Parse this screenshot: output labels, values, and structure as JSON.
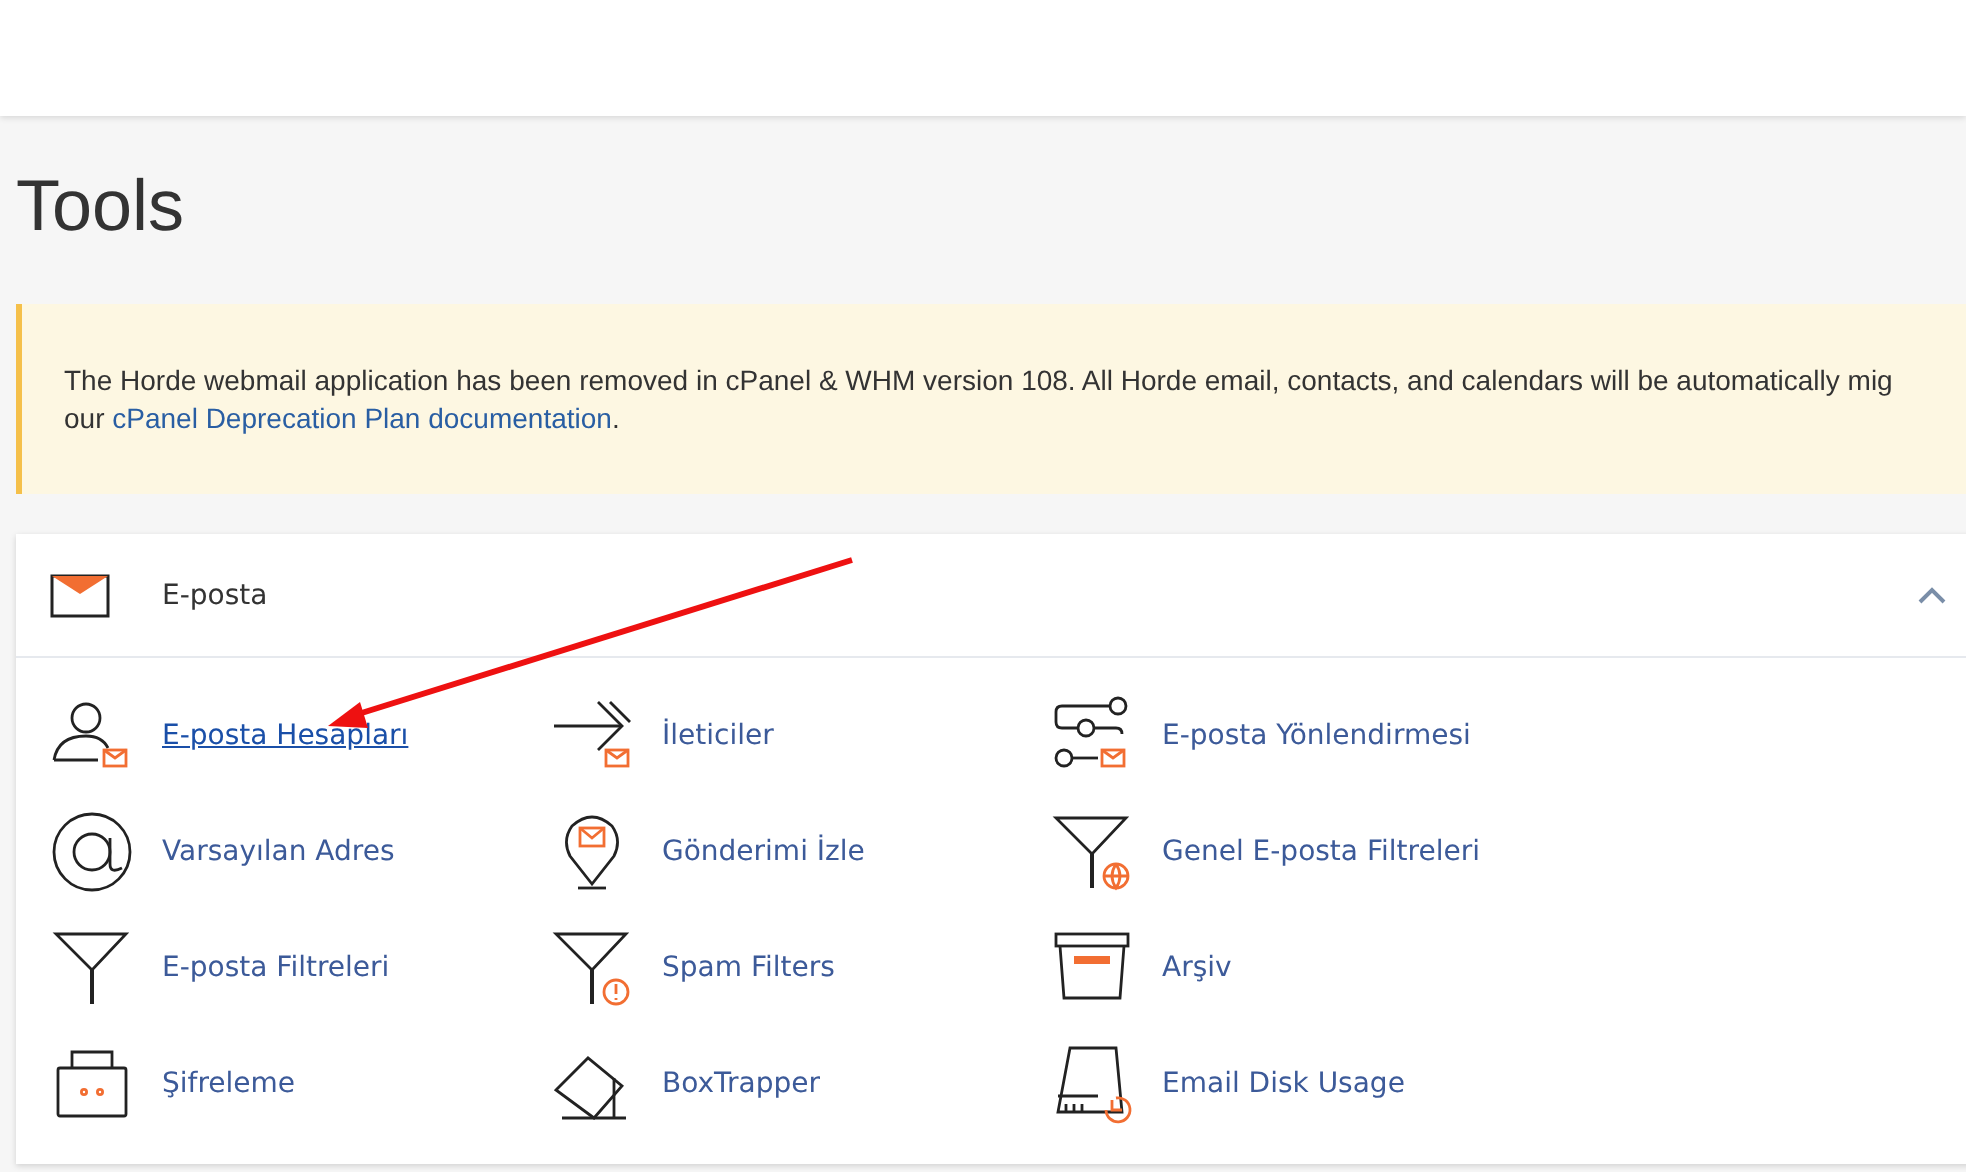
{
  "page_title": "Tools",
  "notice": {
    "text": "The Horde webmail application has been removed in cPanel & WHM version 108. All Horde email, contacts, and calendars will be automatically mig",
    "text_2": "our ",
    "link": "cPanel Deprecation Plan documentation",
    "text_3": "."
  },
  "section": {
    "title": "E-posta",
    "expanded": true,
    "items": [
      {
        "label": "E-posta Hesapları",
        "hovered": true
      },
      {
        "label": "İleticiler",
        "hovered": false
      },
      {
        "label": "E-posta Yönlendirmesi",
        "hovered": false
      },
      {
        "label": "Varsayılan Adres",
        "hovered": false
      },
      {
        "label": "Gönderimi İzle",
        "hovered": false
      },
      {
        "label": "Genel E-posta Filtreleri",
        "hovered": false
      },
      {
        "label": "E-posta Filtreleri",
        "hovered": false
      },
      {
        "label": "Spam Filters",
        "hovered": false
      },
      {
        "label": "Arşiv",
        "hovered": false
      },
      {
        "label": "Şifreleme",
        "hovered": false
      },
      {
        "label": "BoxTrapper",
        "hovered": false
      },
      {
        "label": "Email Disk Usage",
        "hovered": false
      }
    ]
  }
}
